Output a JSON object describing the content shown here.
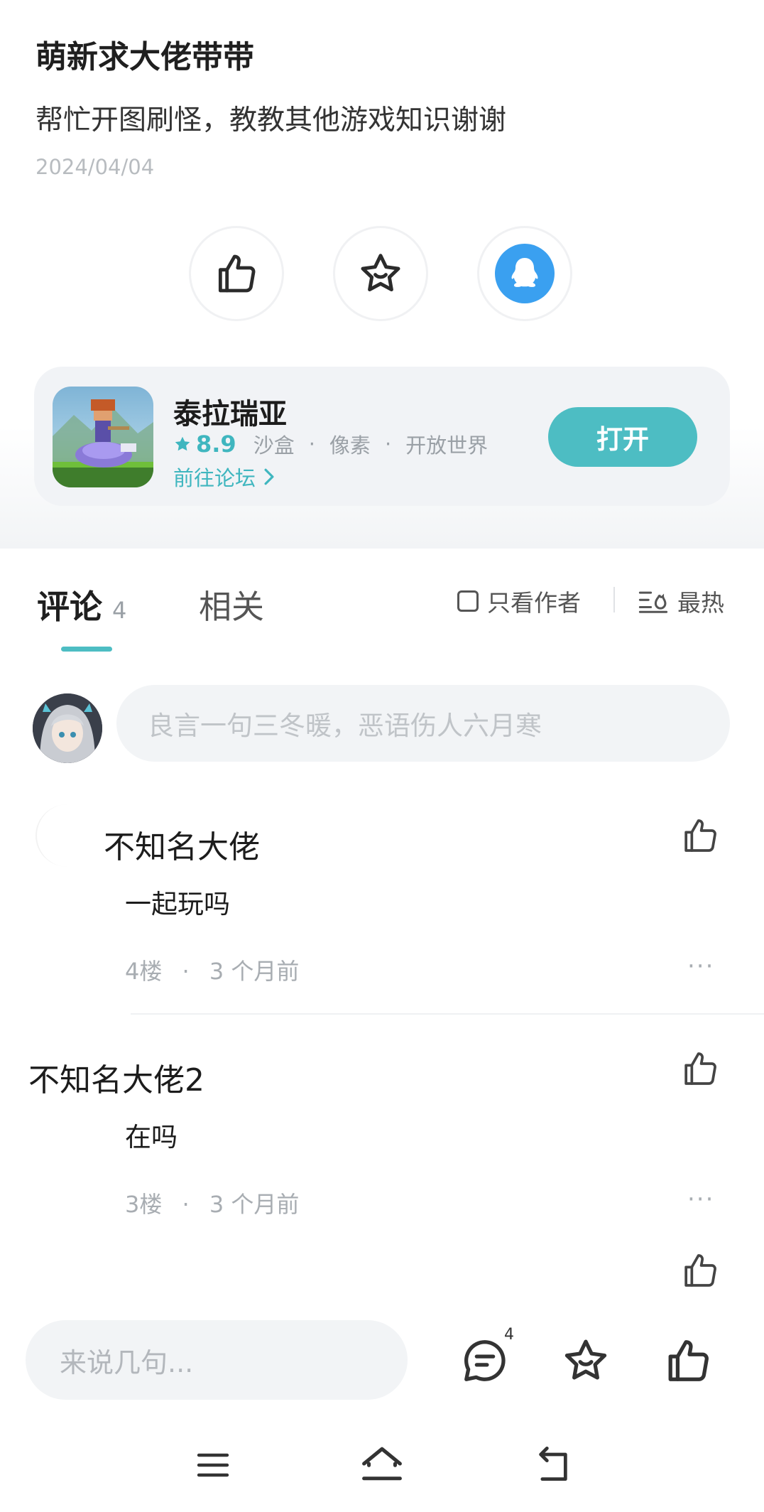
{
  "post": {
    "title": "萌新求大佬带带",
    "body": "帮忙开图刷怪，教教其他游戏知识谢谢",
    "date": "2024/04/04"
  },
  "actions": [
    {
      "icon": "thumbs-up-icon"
    },
    {
      "icon": "star-icon"
    },
    {
      "icon": "qq-penguin-icon"
    }
  ],
  "game": {
    "name": "泰拉瑞亚",
    "rating": "8.9",
    "tags": [
      "沙盒",
      "像素",
      "开放世界"
    ],
    "separator": "·",
    "forum_link": "前往论坛",
    "open_label": "打开"
  },
  "tabs": {
    "comments_label": "评论",
    "comments_count": "4",
    "related_label": "相关",
    "author_only_label": "只看作者",
    "sort_label": "最热"
  },
  "comment_input": {
    "placeholder": "良言一句三冬暖，恶语伤人六月寒"
  },
  "comments": [
    {
      "author": "不知名大佬",
      "text": "一起玩吗",
      "floor": "4楼",
      "time": "3 个月前"
    },
    {
      "author": "不知名大佬2",
      "text": "在吗",
      "floor": "3楼",
      "time": "3 个月前"
    }
  ],
  "meta_separator": "·",
  "more_label": "···",
  "bottom_bar": {
    "placeholder": "来说几句...",
    "comment_count": "4"
  },
  "colors": {
    "accent": "#4dbdc3",
    "qq_blue": "#3aa0f0"
  }
}
